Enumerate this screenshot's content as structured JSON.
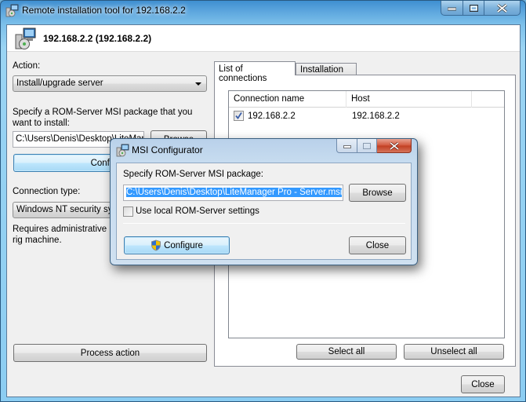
{
  "window": {
    "title": "Remote installation tool for 192.168.2.2",
    "caption_buttons": [
      "minimize",
      "maximize",
      "close"
    ]
  },
  "header": {
    "host_title": "192.168.2.2 (192.168.2.2)"
  },
  "left_panel": {
    "action_label": "Action:",
    "action_selected": "Install/upgrade server",
    "msi_label": "Specify a ROM-Server MSI package that you want to install:",
    "msi_path": "C:\\Users\\Denis\\Desktop\\LiteMana",
    "browse_label": "Browse",
    "configure_label": "Configure",
    "connection_type_label": "Connection type:",
    "connection_type_selected": "Windows NT security syst",
    "requirement_text": "Requires administrative rig machine.",
    "process_label": "Process action"
  },
  "right_panel": {
    "tabs": [
      {
        "label": "List of connections",
        "active": true
      },
      {
        "label": "Installation log",
        "active": false
      }
    ],
    "columns": [
      "Connection name",
      "Host"
    ],
    "rows": [
      {
        "checked": true,
        "name": "192.168.2.2",
        "host": "192.168.2.2"
      }
    ],
    "select_all_label": "Select all",
    "unselect_all_label": "Unselect all"
  },
  "footer": {
    "close_label": "Close"
  },
  "dialog": {
    "title": "MSI Configurator",
    "prompt": "Specify ROM-Server MSI package:",
    "msi_path": "C:\\Users\\Denis\\Desktop\\LiteManager Pro - Server.msi",
    "browse_label": "Browse",
    "use_local_label": "Use local ROM-Server settings",
    "use_local_checked": false,
    "configure_label": "Configure",
    "close_label": "Close"
  },
  "colors": {
    "selection": "#3399ff",
    "focus_button": "#bee6fd",
    "dialog_close": "#c13e22"
  }
}
